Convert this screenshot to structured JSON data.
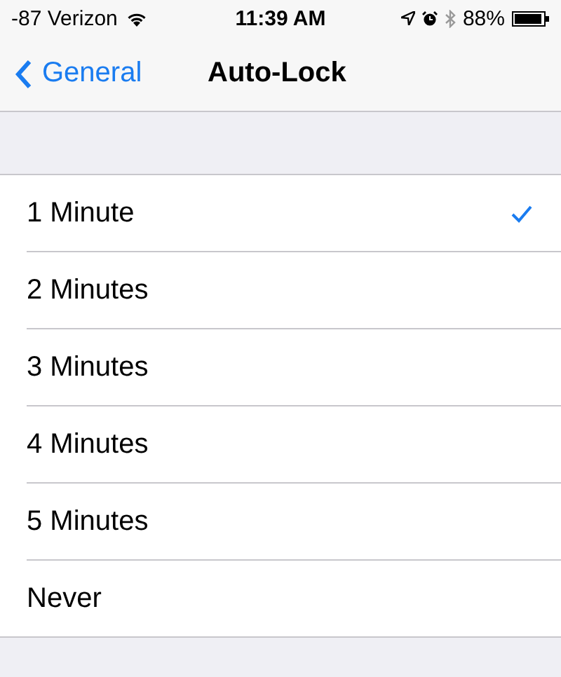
{
  "status_bar": {
    "carrier": "-87 Verizon",
    "time": "11:39 AM",
    "battery": "88%"
  },
  "nav": {
    "back": "General",
    "title": "Auto-Lock"
  },
  "options": [
    {
      "label": "1 Minute",
      "selected": true
    },
    {
      "label": "2 Minutes",
      "selected": false
    },
    {
      "label": "3 Minutes",
      "selected": false
    },
    {
      "label": "4 Minutes",
      "selected": false
    },
    {
      "label": "5 Minutes",
      "selected": false
    },
    {
      "label": "Never",
      "selected": false
    }
  ]
}
